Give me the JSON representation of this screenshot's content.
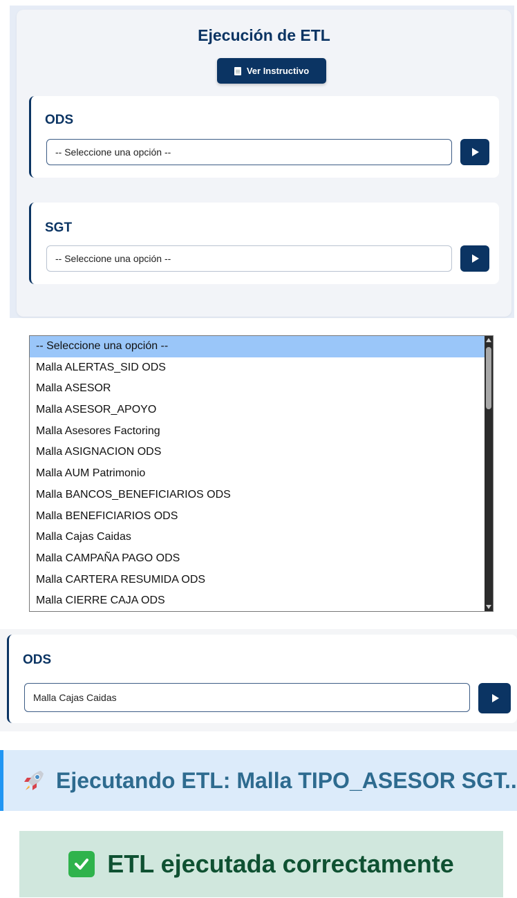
{
  "header": {
    "title": "Ejecución de ETL",
    "instructivo_label": "Ver Instructivo"
  },
  "ods": {
    "title": "ODS",
    "selected": "-- Seleccione una opción --"
  },
  "sgt": {
    "title": "SGT",
    "selected": "-- Seleccione una opción --"
  },
  "dropdown": {
    "options": [
      "-- Seleccione una opción --",
      "Malla ALERTAS_SID ODS",
      "Malla ASESOR",
      "Malla ASESOR_APOYO",
      "Malla Asesores Factoring",
      "Malla ASIGNACION ODS",
      "Malla AUM Patrimonio",
      "Malla BANCOS_BENEFICIARIOS ODS",
      "Malla BENEFICIARIOS ODS",
      "Malla Cajas Caidas",
      "Malla CAMPAÑA PAGO ODS",
      "Malla CARTERA RESUMIDA ODS",
      "Malla CIERRE CAJA ODS"
    ]
  },
  "ods_selected_state": {
    "title": "ODS",
    "selected": "Malla Cajas Caidas"
  },
  "status": {
    "running": "Ejecutando ETL: Malla TIPO_ASESOR SGT...",
    "success": "ETL ejecutada correctamente"
  },
  "colors": {
    "primary": "#0b3463",
    "info_bg": "#dcebfa",
    "info_border": "#2196f3",
    "success_bg": "#d0e7dd",
    "success_text": "#0f5132",
    "highlight": "#9ac6f9"
  }
}
